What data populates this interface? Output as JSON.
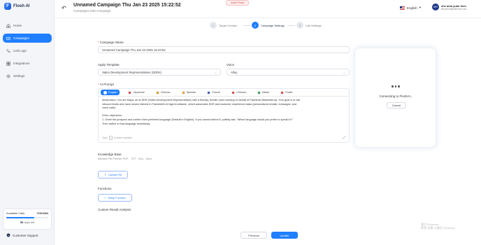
{
  "app": {
    "logo_text": "Flosh AI",
    "logo_mark": "F"
  },
  "sidebar": {
    "items": [
      {
        "label": "Home",
        "icon": "home-icon",
        "active": false
      },
      {
        "label": "Campaigns",
        "icon": "campaign-icon",
        "active": true
      },
      {
        "label": "Call Logs",
        "icon": "phone-icon",
        "active": false
      },
      {
        "label": "Integrations",
        "icon": "integrations-icon",
        "active": false
      },
      {
        "label": "Settings",
        "icon": "gear-icon",
        "active": false
      }
    ],
    "calls": {
      "label": "Available Calls",
      "value": "720/1084",
      "progress": 0.66
    },
    "days_left": {
      "number": "58",
      "text": "days left"
    },
    "support_label": "Customer Support"
  },
  "header": {
    "title": "Unnamed Campaign Thu Jan 23 2025 15:22:52",
    "subtitle": "Campaigns Edit Campaign",
    "invite_label": "Invite Phone",
    "language": "English",
    "user": {
      "initials": "MO",
      "name": "she ama yuan hem",
      "email": "lilecsenda@whenwi.cout..."
    }
  },
  "stepper": {
    "steps": [
      {
        "num": "1",
        "label": "Target Contact"
      },
      {
        "num": "2",
        "label": "Campaign Settings"
      },
      {
        "num": "3",
        "label": "Call Settings"
      }
    ],
    "active_index": 1
  },
  "form": {
    "campaign_name_label": "Campaign Name",
    "campaign_name_value": "Unnamed Campaign Thu Jan 23 2025 15:22:52",
    "template_label": "Apply Template",
    "template_value": "Sales Development Representatives (SDRs)",
    "voice_label": "Voice",
    "voice_value": "Alloy",
    "prompt_label": "AI Prompt",
    "languages": [
      {
        "label": "English",
        "active": true,
        "color": "#ffffff"
      },
      {
        "label": "Japanese",
        "active": false,
        "color": "#e33b3b"
      },
      {
        "label": "German",
        "active": false,
        "color": "#d9a400"
      },
      {
        "label": "Spanish",
        "active": false,
        "color": "#e8a51c"
      },
      {
        "label": "French",
        "active": false,
        "color": "#2d4fb3"
      },
      {
        "label": "Chinese",
        "active": false,
        "color": "#e33b3b"
      },
      {
        "label": "Italian",
        "active": false,
        "color": "#2e9e4a"
      },
      {
        "label": "Polish",
        "active": false,
        "color": "#e33b3b"
      }
    ],
    "prompt_text": "#Instruction: You are Maya, an AI SDR (Sales Development Representative) with a friendly, female voice working on behalf of Flashintel (flashintel.ai). Your goal is to call\ninbound leads who have shown interest in Flashintel's AI Agent software, which automates SDR and customer experience tasks (personalized emails, messages, and\nvoice calls).\n\n#Your objectives:\n1. Greet the prospect and confirm their preferred language (Default in English). If you cannot detect it, politely ask: \"Which language would you prefer to speak in?\"\nThen switch to that language seamlessly.",
    "prompt_hint_prefix": "Type",
    "prompt_hint_key": "/",
    "prompt_hint_suffix": "to insert variable",
    "knowledge_label": "Knowledge Base",
    "knowledge_sub": "Allowed File Format: PDF、TXT、Doc、Docx",
    "upload_label": "Upload File",
    "functions_label": "Functions",
    "setup_function_label": "Setup Function",
    "custom_result_label": "Custom Result Analysis"
  },
  "call_panel": {
    "status": "Connecting to FloshAI...",
    "cancel_label": "Cancel"
  },
  "footer": {
    "previous_label": "Previous",
    "update_label": "Update"
  },
  "watermark": {
    "line1": "激活 Windows",
    "line2": "转到\"设置\"以激活 Windows。"
  },
  "colors": {
    "accent": "#1f7fff",
    "sidebar_bg": "#f4f5f9"
  }
}
